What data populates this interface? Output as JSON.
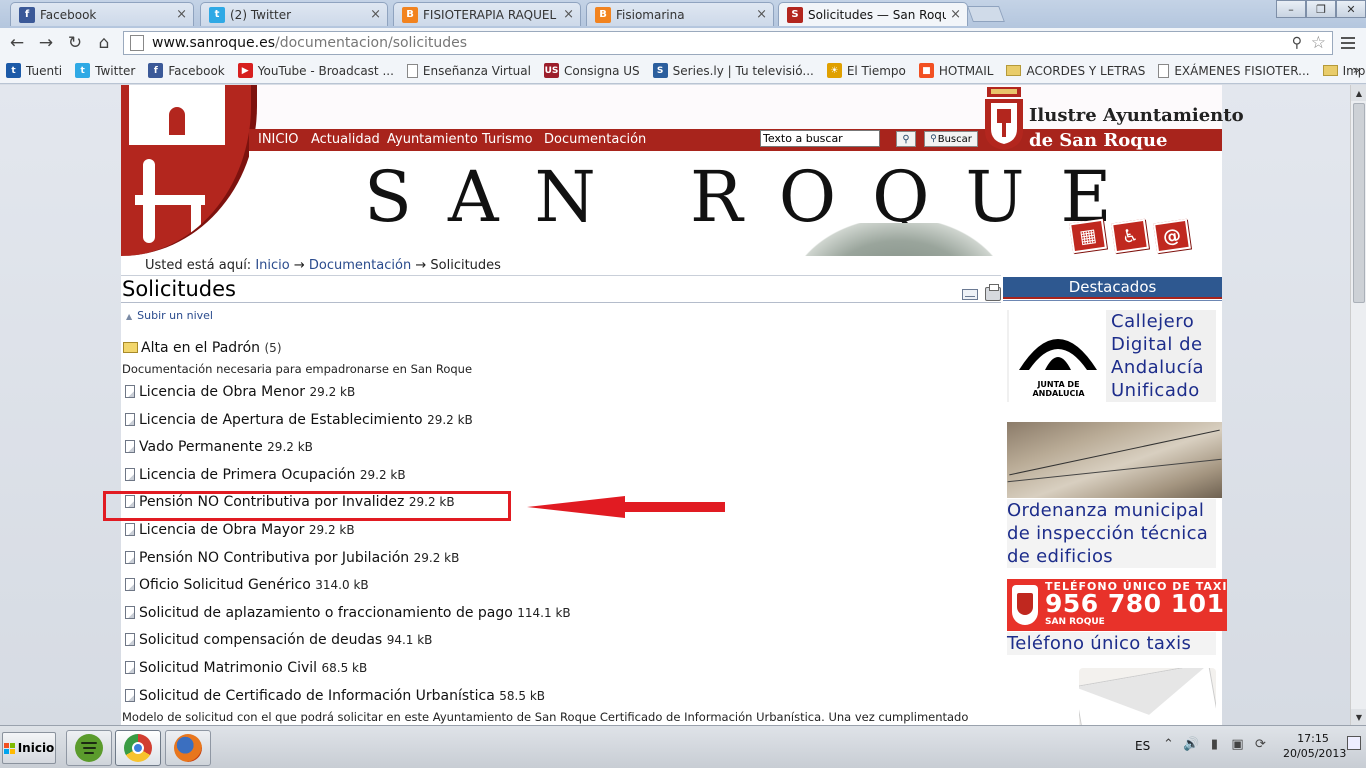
{
  "tabs": [
    {
      "label": "Facebook",
      "favicon": "f",
      "color": "#3b5998",
      "close": "×"
    },
    {
      "label": "(2) Twitter",
      "favicon": "t",
      "color": "#2fa9e5",
      "close": "×"
    },
    {
      "label": "FISIOTERAPIA RAQUEL CHI",
      "favicon": "B",
      "color": "#f2831f",
      "close": "×"
    },
    {
      "label": "Fisiomarina",
      "favicon": "B",
      "color": "#f2831f",
      "close": "×"
    },
    {
      "label": "Solicitudes — San Roque",
      "favicon": "S",
      "color": "#b3261e",
      "close": "×"
    }
  ],
  "window_controls": {
    "minimize": "–",
    "restore": "❐",
    "close": "✕"
  },
  "toolbar": {
    "back": "←",
    "forward": "→",
    "reload": "↻",
    "home": "⌂",
    "zoom_icon": "⚲",
    "star_icon": "☆"
  },
  "url": {
    "host": "www.sanroque.es",
    "path": "/documentacion/solicitudes"
  },
  "bookmarks": [
    {
      "label": "Tuenti",
      "type": "icon",
      "glyph": "t",
      "color": "#1c5aa8"
    },
    {
      "label": "Twitter",
      "type": "icon",
      "glyph": "t",
      "color": "#2fa9e5"
    },
    {
      "label": "Facebook",
      "type": "icon",
      "glyph": "f",
      "color": "#3b5998"
    },
    {
      "label": "YouTube - Broadcast ...",
      "type": "icon",
      "glyph": "▶",
      "color": "#d71f1f"
    },
    {
      "label": "Enseñanza Virtual",
      "type": "page"
    },
    {
      "label": "Consigna US",
      "type": "icon",
      "glyph": "US",
      "color": "#9c1e2b"
    },
    {
      "label": "Series.ly | Tu televisió...",
      "type": "icon",
      "glyph": "S",
      "color": "#2c5f9e"
    },
    {
      "label": "El Tiempo",
      "type": "icon",
      "glyph": "☀",
      "color": "#e0a000"
    },
    {
      "label": "HOTMAIL",
      "type": "icon",
      "glyph": "■",
      "color": "#f25022"
    },
    {
      "label": "ACORDES Y LETRAS",
      "type": "folder"
    },
    {
      "label": "EXÁMENES FISIOTER...",
      "type": "page"
    },
    {
      "label": "Importado desde Firef...",
      "type": "folder"
    }
  ],
  "bookmarks_more": "»",
  "site": {
    "nav": [
      "INICIO",
      "Actualidad",
      "Ayuntamiento",
      "Turismo",
      "Documentación"
    ],
    "search_placeholder": "Texto a buscar",
    "search_icon": "⚲",
    "search_button": "Buscar",
    "ayto_line1": "Ilustre Ayuntamiento",
    "ayto_line2": "de San Roque",
    "banner_title": "SAN ROQUE",
    "header_icons": {
      "calendar": "▦",
      "accessibility": "♿",
      "email": "@"
    }
  },
  "breadcrumb": {
    "prefix": "Usted está aquí:",
    "inicio": "Inicio",
    "documentacion": "Documentación",
    "current": "Solicitudes",
    "sep": "→"
  },
  "page_title": "Solicitudes",
  "up_level": {
    "arrow": "▲",
    "label": "Subir un nivel"
  },
  "folder": {
    "name": "Alta en el Padrón",
    "count": "(5)",
    "description": "Documentación necesaria para empadronarse en San Roque"
  },
  "documents": [
    {
      "name": "Licencia de Obra Menor",
      "size": "29.2 kB"
    },
    {
      "name": "Licencia de Apertura de Establecimiento",
      "size": "29.2 kB"
    },
    {
      "name": "Vado Permanente",
      "size": "29.2 kB"
    },
    {
      "name": "Licencia de Primera Ocupación",
      "size": "29.2 kB"
    },
    {
      "name": "Pensión NO Contributiva por Invalidez",
      "size": "29.2 kB"
    },
    {
      "name": "Licencia de Obra Mayor",
      "size": "29.2 kB"
    },
    {
      "name": "Pensión NO Contributiva por Jubilación",
      "size": "29.2 kB"
    },
    {
      "name": "Oficio Solicitud Genérico",
      "size": "314.0 kB"
    },
    {
      "name": "Solicitud de aplazamiento o fraccionamiento de pago",
      "size": "114.1 kB"
    },
    {
      "name": "Solicitud compensación de deudas",
      "size": "94.1 kB"
    },
    {
      "name": "Solicitud Matrimonio Civil",
      "size": "68.5 kB"
    },
    {
      "name": "Solicitud de Certificado de Información Urbanística",
      "size": "58.5 kB"
    }
  ],
  "last_doc_description": "Modelo de solicitud con el que podrá solicitar en este Ayuntamiento de San Roque Certificado de Información Urbanística. Una vez cumplimentado",
  "annotation": {
    "highlight_color": "#e11b22"
  },
  "sidebar": {
    "heading": "Destacados",
    "callejero": {
      "lines": [
        "Callejero",
        "Digital de",
        "Andalucía",
        "Unificado"
      ],
      "logo_text": "JUNTA DE ANDALUCIA"
    },
    "ordenanza": {
      "lines": [
        "Ordenanza municipal",
        "de inspección técnica",
        "de edificios"
      ]
    },
    "taxi": {
      "banner_top": "TELÉFONO ÚNICO DE TAXI",
      "number": "956 780 101",
      "city": "SAN ROQUE",
      "caption": "Teléfono único taxis"
    }
  },
  "taskbar": {
    "start": "Inicio",
    "language": "ES",
    "tray": {
      "chevron": "⌃",
      "volume": "🔊",
      "network": "▮",
      "battery": "▣",
      "sync": "⟳"
    },
    "time": "17:15",
    "date": "20/05/2013"
  }
}
